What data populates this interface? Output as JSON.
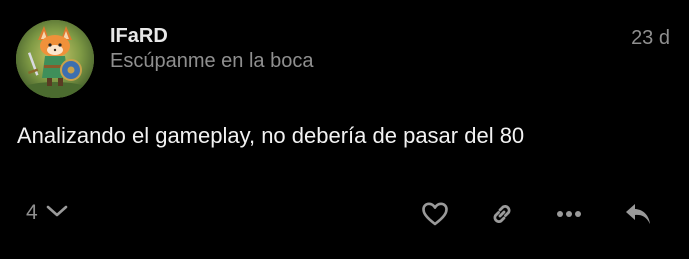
{
  "post": {
    "author": {
      "username": "IFaRD",
      "title": "Escúpanme en la boca",
      "avatar_icon": "fox-knight-avatar"
    },
    "date": "23 d",
    "body": "Analizando el gameplay, no debería de pasar del 80",
    "likes": {
      "count": "4",
      "icon": "chevron-down-icon"
    },
    "actions": [
      {
        "name": "like",
        "icon": "heart-icon"
      },
      {
        "name": "copy-link",
        "icon": "link-icon"
      },
      {
        "name": "more",
        "icon": "more-icon"
      },
      {
        "name": "reply",
        "icon": "reply-icon"
      }
    ],
    "colors": {
      "background": "#000000",
      "primary_text": "#f2f2f2",
      "muted_text": "#8f8f8f",
      "icon": "#9a9a9a"
    }
  }
}
